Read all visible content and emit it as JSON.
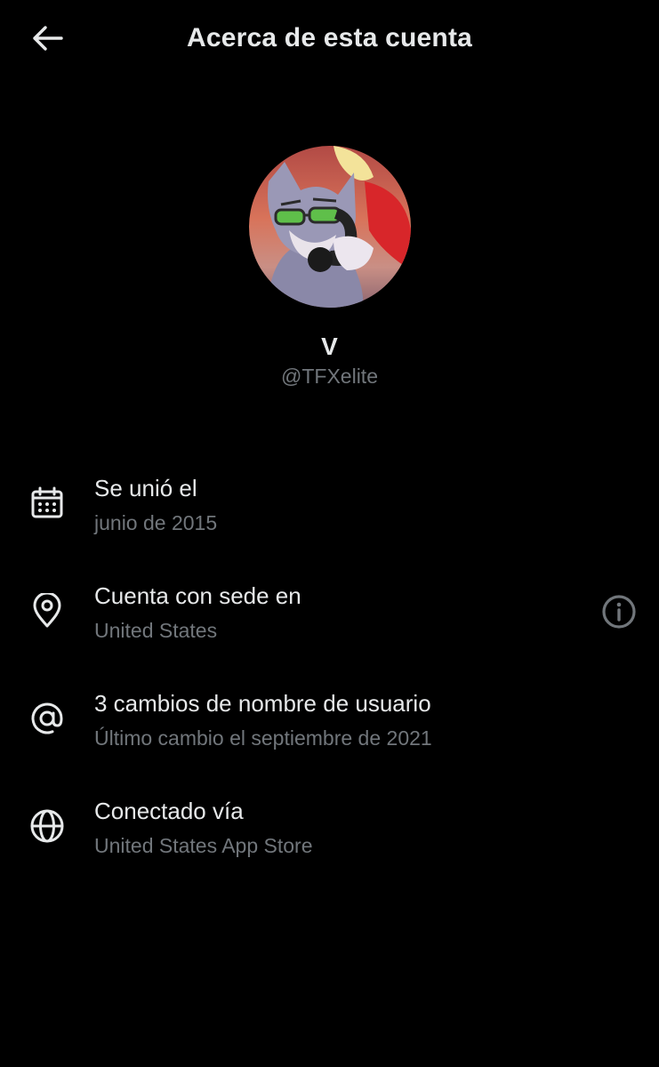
{
  "header": {
    "title": "Acerca de esta cuenta",
    "back_icon": "arrow-left-icon"
  },
  "profile": {
    "display_name": "V",
    "handle": "@TFXelite",
    "avatar": "cartoon-cat-with-sunglasses-on-phone"
  },
  "rows": [
    {
      "icon": "calendar-icon",
      "title": "Se unió el",
      "subtitle": "junio de 2015"
    },
    {
      "icon": "location-pin-icon",
      "title": "Cuenta con sede en",
      "subtitle": "United States",
      "action_icon": "info-icon"
    },
    {
      "icon": "at-sign-icon",
      "title": "3 cambios de nombre de usuario",
      "subtitle": "Último cambio el septiembre de 2021"
    },
    {
      "icon": "globe-icon",
      "title": "Conectado vía",
      "subtitle": "United States App Store"
    }
  ],
  "colors": {
    "background": "#000000",
    "primary_text": "#e7e9ea",
    "secondary_text": "#71767b"
  }
}
